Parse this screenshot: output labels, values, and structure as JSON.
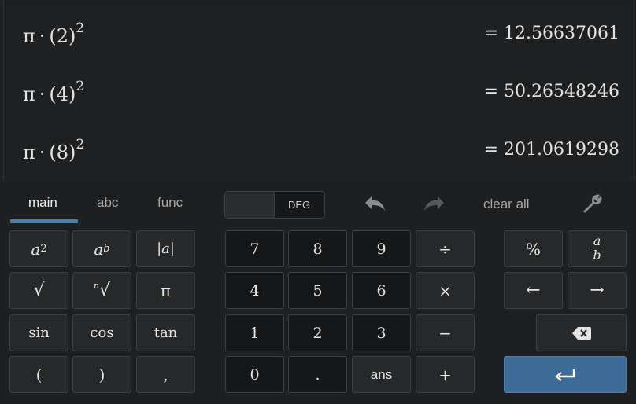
{
  "expressions": [
    {
      "pre": "π",
      "dot": "·",
      "base": "(2)",
      "exp": "2",
      "result": "= 12.56637061"
    },
    {
      "pre": "π",
      "dot": "·",
      "base": "(4)",
      "exp": "2",
      "result": "= 50.26548246"
    },
    {
      "pre": "π",
      "dot": "·",
      "base": "(8)",
      "exp": "2",
      "result": "= 201.0619298"
    }
  ],
  "tabs": {
    "main": "main",
    "abc": "abc",
    "func": "func",
    "active": "main"
  },
  "angle_mode": {
    "label": "DEG",
    "state": "off"
  },
  "toolbar": {
    "clear_all": "clear all",
    "undo_icon": "undo-icon",
    "redo_icon": "redo-icon",
    "settings_icon": "wrench-icon"
  },
  "keys": {
    "a_squared_base": "a",
    "a_squared_exp": "2",
    "a_power_base": "a",
    "a_power_exp": "b",
    "abs": "|a|",
    "sqrt": "√",
    "nthroot_index": "n",
    "nthroot_sign": "√",
    "pi": "π",
    "sin": "sin",
    "cos": "cos",
    "tan": "tan",
    "lparen": "(",
    "rparen": ")",
    "comma": ",",
    "n7": "7",
    "n8": "8",
    "n9": "9",
    "div": "÷",
    "n4": "4",
    "n5": "5",
    "n6": "6",
    "mul": "×",
    "n1": "1",
    "n2": "2",
    "n3": "3",
    "minus": "−",
    "n0": "0",
    "point": ".",
    "ans": "ans",
    "plus": "+",
    "percent": "%",
    "frac_num": "a",
    "frac_den": "b",
    "left": "←",
    "right": "→",
    "backspace_icon": "backspace-icon",
    "enter_icon": "enter-icon"
  },
  "colors": {
    "background": "#1d1f21",
    "accent": "#4a7fb3",
    "enter": "#3e6b98"
  }
}
